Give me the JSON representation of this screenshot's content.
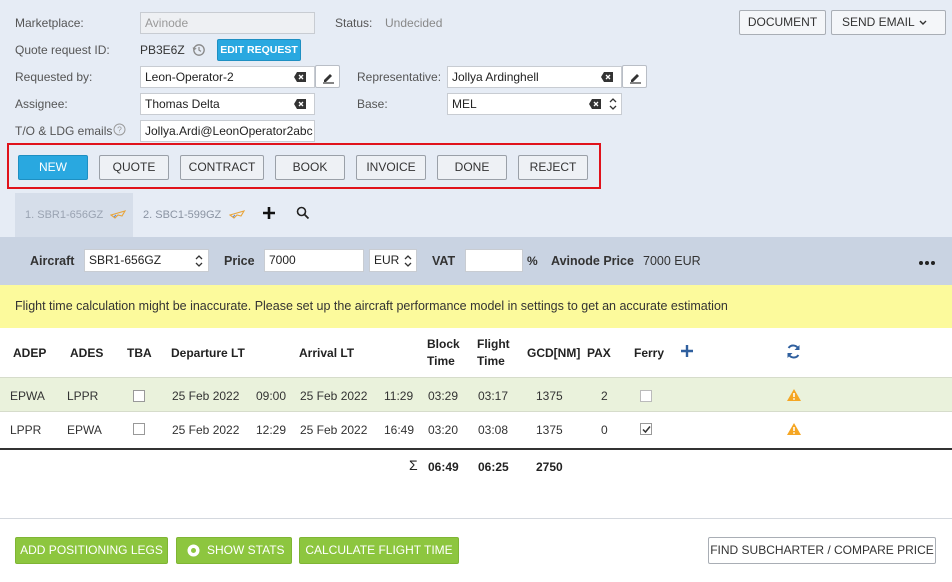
{
  "header": {
    "marketplace_label": "Marketplace:",
    "marketplace_value": "Avinode",
    "status_label": "Status:",
    "status_value": "Undecided",
    "quote_id_label": "Quote request ID:",
    "quote_id_value": "PB3E6Z",
    "edit_request_label": "EDIT REQUEST",
    "requested_by_label": "Requested by:",
    "requested_by_value": "Leon-Operator-2",
    "representative_label": "Representative:",
    "representative_value": "Jollya Ardinghell",
    "assignee_label": "Assignee:",
    "assignee_value": "Thomas Delta",
    "base_label": "Base:",
    "base_value": "MEL",
    "emails_label": "T/O & LDG emails",
    "emails_value": "Jollya.Ardi@LeonOperator2abc",
    "document_label": "DOCUMENT",
    "send_email_label": "SEND EMAIL"
  },
  "status_buttons": {
    "new": "NEW",
    "quote": "QUOTE",
    "contract": "CONTRACT",
    "book": "BOOK",
    "invoice": "INVOICE",
    "done": "DONE",
    "reject": "REJECT"
  },
  "tabs": [
    {
      "label": "1. SBR1-656GZ"
    },
    {
      "label": "2. SBC1-599GZ"
    }
  ],
  "aircraft_bar": {
    "aircraft_label": "Aircraft",
    "aircraft_value": "SBR1-656GZ",
    "price_label": "Price",
    "price_value": "7000",
    "currency_value": "EUR",
    "vat_label": "VAT",
    "vat_value": "",
    "percent": "%",
    "avinode_price_label": "Avinode Price",
    "avinode_price_value": "7000 EUR"
  },
  "warning": "Flight time calculation might be inaccurate. Please set up the aircraft performance model in settings to get an accurate estimation",
  "table": {
    "headers": {
      "adep": "ADEP",
      "ades": "ADES",
      "tba": "TBA",
      "departure": "Departure LT",
      "arrival": "Arrival LT",
      "block_time_1": "Block",
      "block_time_2": "Time",
      "flight_time_1": "Flight",
      "flight_time_2": "Time",
      "gcd": "GCD[NM]",
      "pax": "PAX",
      "ferry": "Ferry"
    },
    "rows": [
      {
        "adep": "EPWA",
        "ades": "LPPR",
        "tba": false,
        "dep_date": "25 Feb 2022",
        "dep_time": "09:00",
        "arr_date": "25 Feb 2022",
        "arr_time": "11:29",
        "block": "03:29",
        "flight": "03:17",
        "gcd": "1375",
        "pax": "2",
        "ferry": false
      },
      {
        "adep": "LPPR",
        "ades": "EPWA",
        "tba": false,
        "dep_date": "25 Feb 2022",
        "dep_time": "12:29",
        "arr_date": "25 Feb 2022",
        "arr_time": "16:49",
        "block": "03:20",
        "flight": "03:08",
        "gcd": "1375",
        "pax": "0",
        "ferry": true
      }
    ],
    "totals": {
      "sigma": "Σ",
      "block": "06:49",
      "flight": "06:25",
      "gcd": "2750"
    }
  },
  "footer": {
    "add_positioning": "ADD POSITIONING LEGS",
    "show_stats": "SHOW STATS",
    "calculate_flight_time": "CALCULATE FLIGHT TIME",
    "find_subcharter": "FIND SUBCHARTER / COMPARE PRICE"
  },
  "colors": {
    "header_bg": "#e6ecf5",
    "accent_blue": "#29a8e0",
    "green": "#8dc63f",
    "warning_bg": "#fcfa9c",
    "highlight_row": "#eaf2dc",
    "warning_icon": "#f5a623"
  }
}
